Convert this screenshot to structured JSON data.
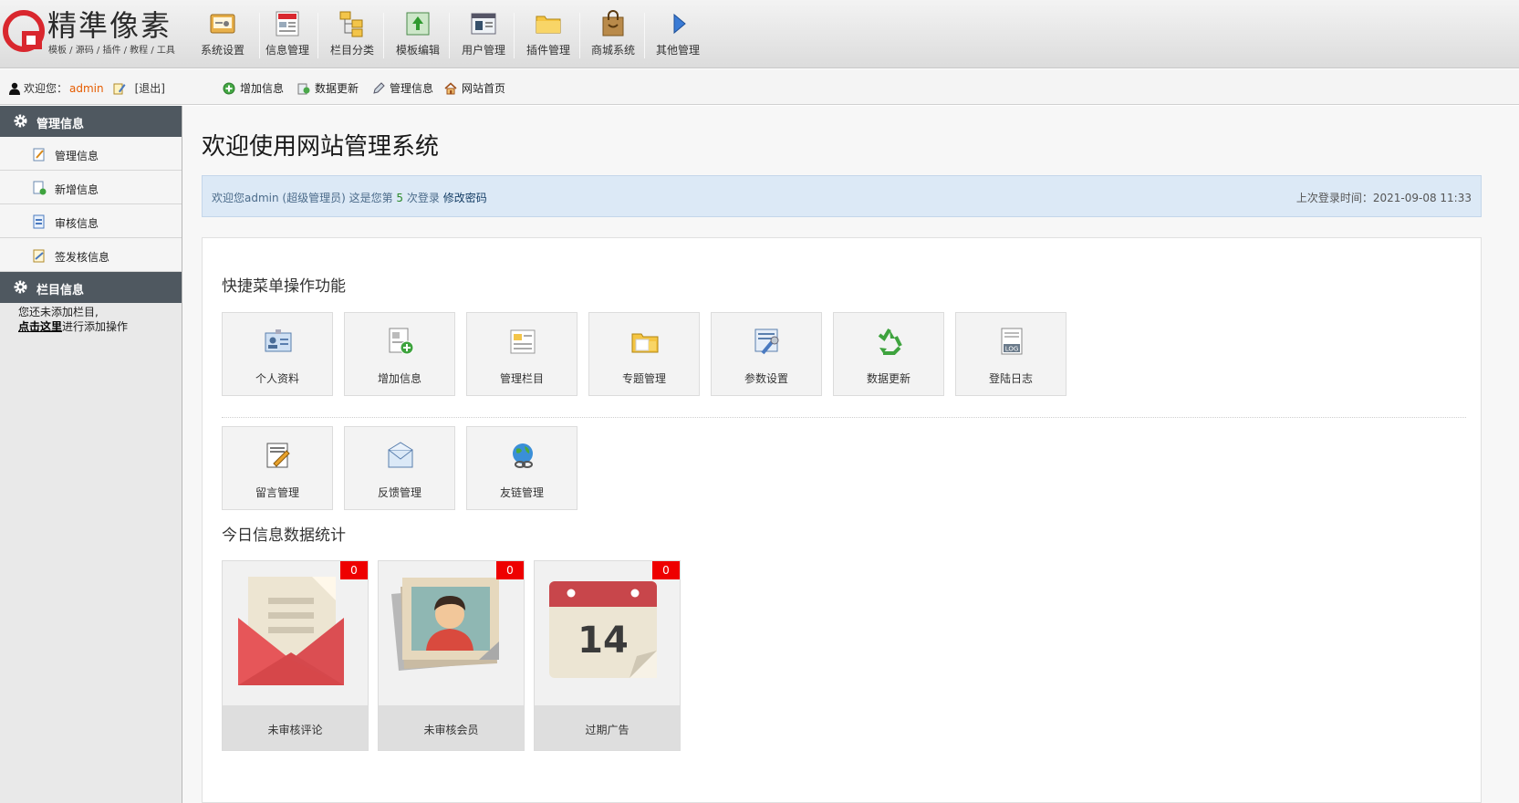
{
  "brand": {
    "title": "精準像素",
    "subtitle": "模板 / 源码 / 插件 / 教程 / 工具"
  },
  "topnav": [
    {
      "label": "系统设置",
      "icon": "system-settings-icon"
    },
    {
      "label": "信息管理",
      "icon": "news-icon"
    },
    {
      "label": "栏目分类",
      "icon": "category-tree-icon"
    },
    {
      "label": "模板编辑",
      "icon": "template-edit-icon"
    },
    {
      "label": "用户管理",
      "icon": "user-card-icon"
    },
    {
      "label": "插件管理",
      "icon": "plugin-folder-icon"
    },
    {
      "label": "商城系统",
      "icon": "shopping-bag-icon"
    },
    {
      "label": "其他管理",
      "icon": "arrow-right-icon"
    }
  ],
  "subbar": {
    "welcome_prefix": "欢迎您：",
    "username": "admin",
    "logout": "[退出]",
    "quick_links": [
      {
        "label": "增加信息",
        "icon": "add-circle-icon"
      },
      {
        "label": "数据更新",
        "icon": "refresh-data-icon"
      },
      {
        "label": "管理信息",
        "icon": "edit-pen-icon"
      },
      {
        "label": "网站首页",
        "icon": "home-icon"
      }
    ]
  },
  "sidebar": {
    "section1": {
      "title": "管理信息",
      "items": [
        {
          "label": "管理信息"
        },
        {
          "label": "新增信息"
        },
        {
          "label": "审核信息"
        },
        {
          "label": "签发核信息"
        }
      ]
    },
    "section2": {
      "title": "栏目信息",
      "note_line1": "您还未添加栏目,",
      "note_link": "点击这里",
      "note_line2": "进行添加操作"
    }
  },
  "main": {
    "title": "欢迎使用网站管理系统",
    "info": {
      "welcome": "欢迎您admin (超级管理员) 这是您第 ",
      "login_count": "5",
      "login_suffix": " 次登录 ",
      "change_password": "修改密码",
      "last_login": "上次登录时间：2021-09-08 11:33"
    },
    "quick_title": "快捷菜单操作功能",
    "quick_row1": [
      "个人资料",
      "增加信息",
      "管理栏目",
      "专题管理",
      "参数设置",
      "数据更新",
      "登陆日志"
    ],
    "quick_row2": [
      "留言管理",
      "反馈管理",
      "友链管理"
    ],
    "stats_title": "今日信息数据统计",
    "stats": [
      {
        "label": "未审核评论",
        "count": "0",
        "icon": "envelope-icon"
      },
      {
        "label": "未审核会员",
        "count": "0",
        "icon": "member-photo-icon"
      },
      {
        "label": "过期广告",
        "count": "0",
        "icon": "calendar-icon",
        "calendar_day": "14"
      }
    ],
    "log_icon_text": "LOG"
  }
}
